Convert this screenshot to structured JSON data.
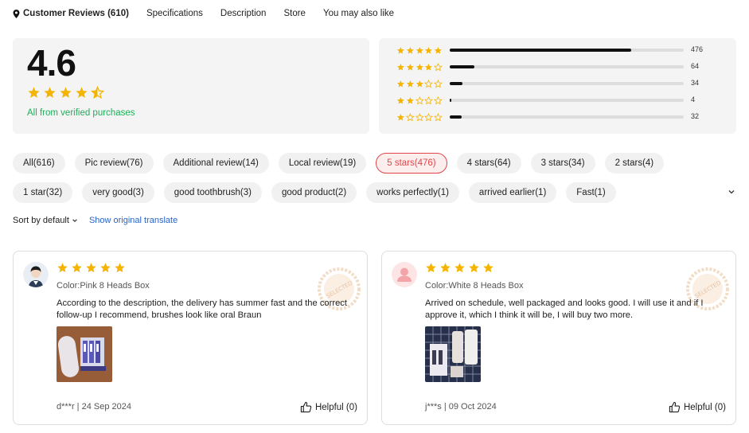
{
  "nav": {
    "items": [
      "Customer Reviews (610)",
      "Specifications",
      "Description",
      "Store",
      "You may also like"
    ]
  },
  "summary": {
    "average": "4.6",
    "rating_value": 4.6,
    "verified_text": "All from verified purchases"
  },
  "distribution": [
    {
      "stars": 5,
      "count": "476",
      "fraction": 0.776
    },
    {
      "stars": 4,
      "count": "64",
      "fraction": 0.104
    },
    {
      "stars": 3,
      "count": "34",
      "fraction": 0.055
    },
    {
      "stars": 2,
      "count": "4",
      "fraction": 0.007
    },
    {
      "stars": 1,
      "count": "32",
      "fraction": 0.052
    }
  ],
  "filters": {
    "row1": [
      "All(616)",
      "Pic review(76)",
      "Additional review(14)",
      "Local review(19)",
      "5 stars(476)",
      "4 stars(64)",
      "3 stars(34)",
      "2 stars(4)"
    ],
    "row2": [
      "1 star(32)",
      "very good(3)",
      "good toothbrush(3)",
      "good product(2)",
      "works perfectly(1)",
      "arrived earlier(1)",
      "Fast(1)"
    ],
    "selected": "5 stars(476)"
  },
  "sort": {
    "label": "Sort by default",
    "translate": "Show original translate"
  },
  "reviews": [
    {
      "rating": 5,
      "color": "Color:Pink 8 Heads Box",
      "text": "According to the description, the delivery has summer fast and the correct follow-up I recommend, brushes look like oral Braun",
      "author_date": "d***r | 24 Sep 2024",
      "helpful": "Helpful (0)",
      "seal": "SELECTED"
    },
    {
      "rating": 5,
      "color": "Color:White 8 Heads Box",
      "text": "Arrived on schedule, well packaged and looks good. I will use it and if I approve it, which I think it will be, I will buy two more.",
      "author_date": "j***s | 09 Oct 2024",
      "helpful": "Helpful (0)",
      "seal": "SELECTED"
    }
  ],
  "colors": {
    "star": "#f5b400",
    "accent_red": "#e0454b",
    "verified_green": "#1fae5b",
    "link_blue": "#2a63c6"
  },
  "icons": [
    "location-pin-icon",
    "star-icon",
    "chevron-down-icon",
    "thumbs-up-icon",
    "selected-seal-icon",
    "user-avatar-icon"
  ]
}
